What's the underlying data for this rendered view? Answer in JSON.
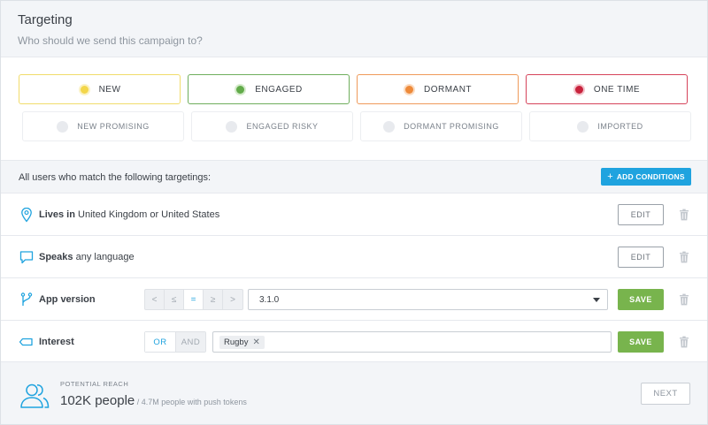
{
  "header": {
    "title": "Targeting",
    "subtitle": "Who should we send this campaign to?"
  },
  "segments": {
    "primary": [
      {
        "label": "NEW",
        "color": "#f3d64a",
        "border": "#f1dc6b"
      },
      {
        "label": "ENGAGED",
        "color": "#62ab4a",
        "border": "#6fae5c"
      },
      {
        "label": "DORMANT",
        "color": "#ee8a3a",
        "border": "#ef9a5a"
      },
      {
        "label": "ONE TIME",
        "color": "#c8233d",
        "border": "#d6435a"
      }
    ],
    "secondary": [
      {
        "label": "NEW PROMISING"
      },
      {
        "label": "ENGAGED RISKY"
      },
      {
        "label": "DORMANT PROMISING"
      },
      {
        "label": "IMPORTED"
      }
    ]
  },
  "conditions": {
    "heading": "All users who match the following targetings:",
    "add_label": "ADD CONDITIONS"
  },
  "rows": {
    "location": {
      "bold": "Lives in",
      "rest": " United Kingdom or United States",
      "button": "EDIT",
      "icon": "location-pin-icon"
    },
    "language": {
      "bold": "Speaks",
      "rest": " any language",
      "button": "EDIT",
      "icon": "speech-bubble-icon"
    },
    "app_version": {
      "bold": "App version",
      "operators": [
        "<",
        "≤",
        "=",
        "≥",
        ">"
      ],
      "active_operator": "=",
      "value": "3.1.0",
      "button": "SAVE",
      "icon": "branch-icon"
    },
    "interest": {
      "bold": "Interest",
      "or_label": "OR",
      "and_label": "AND",
      "tag": "Rugby",
      "tag_remove": "✕",
      "button": "SAVE",
      "icon": "tag-icon"
    }
  },
  "footer": {
    "reach_label": "POTENTIAL REACH",
    "reach_value": "102K people",
    "reach_sub": " / 4.7M people with push tokens",
    "next_label": "NEXT"
  }
}
